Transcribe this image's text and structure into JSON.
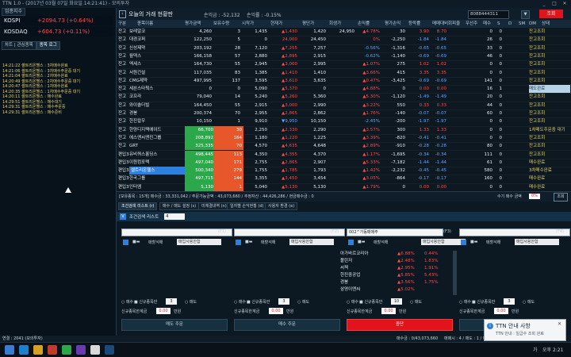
{
  "window": {
    "title": "TTN 1.0 - (2017년 03월 07일 화요일 14:21:41) - 모의투자"
  },
  "left": {
    "market_label": "업종지수",
    "indices": [
      {
        "name": "KOSPI",
        "value": "+2094.73 (+0.64%)"
      },
      {
        "name": "KOSDAQ",
        "value": "+604.73 (+0.11%)"
      }
    ],
    "tabs": [
      "차트 | 관심종목",
      "종목 로그"
    ],
    "log": [
      "14:21:22 셀트리온헬스 : 3차매수완료",
      "14:21:06 셀트리온헬스 : 3차매수주문중 대기",
      "14:21:04 셀트리온헬스 : 2차매수완료",
      "14:20:49 셀트리온헬스 : 2차매수주문중 대기",
      "14:20:47 셀트리온헬스 : 1차매수완료",
      "14:20:35 셀트리온헬스 : 1차매수주문중 대기",
      "14:20:11 셀트리온헬스 : 매수완료",
      "14:29:51 셀트리온헬스 : 매수대기",
      "14:29:31 셀트리온헬스 : 매수주문중",
      "14:29:31 셀트리온헬스 : 매수준비"
    ]
  },
  "main": {
    "title": "오늘의 거래 현황판",
    "profit_label": "손익금 : -52,132",
    "rate_label": "손익률 : -0.15%",
    "account": "8088444311",
    "query_button": "조회",
    "headers": [
      "구분",
      "종목이름",
      "평가금액",
      "보유수량",
      "시작가",
      "현재가",
      "평단가",
      "회생가",
      "손익률",
      "평가손익",
      "등락률",
      "매매대비",
      "회피율",
      "우선주",
      "매수",
      "S",
      "D",
      "SM",
      "DM",
      "상태"
    ],
    "rows": [
      {
        "type": "잔고",
        "name": "보레알코",
        "eval": "4,260",
        "qty": "3",
        "start": "1,435",
        "cur": "▲1,430",
        "avg": "1,420",
        "recov": "24,950",
        "rate": "▲4.78%",
        "pnl": "30",
        "chg": "3.90",
        "vs": "8.70",
        "c1": "0",
        "c2": "0",
        "st": "잔고조회"
      },
      {
        "type": "잔고",
        "name": "대경코퍼",
        "eval": "122,250",
        "qty": "5",
        "start": "0",
        "cur": "24,000",
        "avg": "24,450",
        "recov": "",
        "rate": "0%",
        "pnl": "-2,250",
        "chg": "-1.84",
        "vs": "-1.84",
        "c1": "26",
        "c2": "0",
        "st": "잔고조회"
      },
      {
        "type": "잔고",
        "name": "신성제약",
        "eval": "203,192",
        "qty": "28",
        "start": "7,120",
        "cur": "▲7,255",
        "avg": "7,257",
        "recov": "",
        "rate": "-0.56%",
        "pnl": "-1,316",
        "chg": "-0.65",
        "vs": "-0.65",
        "c1": "33",
        "c2": "0",
        "st": "잔고조회"
      },
      {
        "type": "잔고",
        "name": "월덱스",
        "eval": "166,158",
        "qty": "57",
        "start": "2,880",
        "cur": "▲2,895",
        "avg": "2,915",
        "recov": "",
        "rate": "-0.62%",
        "pnl": "-1,140",
        "chg": "-0.69",
        "vs": "-0.69",
        "c1": "46",
        "c2": "0",
        "st": "잔고조회"
      },
      {
        "type": "잔고",
        "name": "엑세스",
        "eval": "164,730",
        "qty": "55",
        "start": "2,945",
        "cur": "▲3,000",
        "avg": "2,995",
        "recov": "",
        "rate": "▲1.07%",
        "pnl": "275",
        "chg": "1.02",
        "vs": "1.02",
        "c1": "0",
        "c2": "0",
        "st": "잔고조회"
      },
      {
        "type": "잔고",
        "name": "서원건설",
        "eval": "117,035",
        "qty": "83",
        "start": "1,385",
        "cur": "▲1,410",
        "avg": "1,410",
        "recov": "",
        "rate": "▲3.66%",
        "pnl": "415",
        "chg": "3.35",
        "vs": "3.35",
        "c1": "0",
        "c2": "0",
        "st": "잔고조회"
      },
      {
        "type": "잔고",
        "name": "CMG제약",
        "eval": "497,995",
        "qty": "137",
        "start": "3,595",
        "cur": "▲3,610",
        "avg": "3,635",
        "recov": "",
        "rate": "▲0.47%",
        "pnl": "-3,425",
        "chg": "-0.69",
        "vs": "-0.69",
        "c1": "141",
        "c2": "0",
        "st": "잔고조회"
      },
      {
        "type": "잔고",
        "name": "세븐스타웍스",
        "eval": "0",
        "qty": "0",
        "start": "5,090",
        "cur": "▲5,370",
        "avg": "0",
        "recov": "",
        "rate": "▲4.88%",
        "pnl": "0",
        "chg": "0.00",
        "vs": "0.00",
        "c1": "16",
        "c2": "1",
        "st": "매도완료"
      },
      {
        "type": "잔고",
        "name": "코프라",
        "eval": "79,040",
        "qty": "14",
        "start": "5,240",
        "cur": "▲5,260",
        "avg": "5,360",
        "recov": "",
        "rate": "▲5.30%",
        "pnl": "-1,120",
        "chg": "-1.49",
        "vs": "-1.49",
        "c1": "20",
        "c2": "0",
        "st": "잔고조회"
      },
      {
        "type": "잔고",
        "name": "와이솔더빌",
        "eval": "164,450",
        "qty": "55",
        "start": "2,915",
        "cur": "▲3,000",
        "avg": "2,990",
        "recov": "",
        "rate": "▲3.22%",
        "pnl": "550",
        "chg": "0.33",
        "vs": "0.33",
        "c1": "44",
        "c2": "0",
        "st": "잔고조회"
      },
      {
        "type": "잔고",
        "name": "경봉",
        "eval": "200,374",
        "qty": "70",
        "start": "2,955",
        "cur": "▲2,865",
        "avg": "2,862",
        "recov": "",
        "rate": "▲1.76%",
        "pnl": "-140",
        "chg": "-0.07",
        "vs": "-0.07",
        "c1": "60",
        "c2": "0",
        "st": "잔고조회"
      },
      {
        "type": "잔고",
        "name": "한진칼우",
        "eval": "10,150",
        "qty": "1",
        "start": "9,910",
        "cur": "▼9,950",
        "avg": "10,150",
        "recov": "",
        "rate": "-2.45%",
        "pnl": "-200",
        "chg": "-1.97",
        "vs": "-1.97",
        "c1": "0",
        "c2": "0",
        "st": "잔고조회"
      },
      {
        "type": "잔고",
        "name": "한양디지텍에이드",
        "eval": "66,700",
        "qty": "30",
        "start": "2,250",
        "cur": "▲2,330",
        "avg": "2,290",
        "recov": "",
        "rate": "▲3.57%",
        "pnl": "300",
        "chg": "1.33",
        "vs": "1.33",
        "c1": "0",
        "c2": "0",
        "st": "1차매도주문중 대기"
      },
      {
        "type": "잔고",
        "name": "에스엔씨엔진그룹",
        "eval": "208,892",
        "qty": "164",
        "start": "1,180",
        "cur": "▲1,220",
        "avg": "1,225",
        "recov": "",
        "rate": "▲3.39%",
        "pnl": "-820",
        "chg": "-0.41",
        "vs": "-0.41",
        "c1": "0",
        "c2": "0",
        "st": "잔고조회"
      },
      {
        "type": "잔고",
        "name": "GRT",
        "eval": "325,335",
        "qty": "70",
        "start": "4,570",
        "cur": "▲4,635",
        "avg": "4,648",
        "recov": "",
        "rate": "▲2.89%",
        "pnl": "-910",
        "chg": "-0.28",
        "vs": "-0.28",
        "c1": "80",
        "c2": "0",
        "st": "잔고조회"
      },
      {
        "type": "편입3",
        "name": "유비쿼스홀딩스",
        "eval": "498,445",
        "qty": "113",
        "start": "4,350",
        "cur": "▲4,355",
        "avg": "4,370",
        "recov": "",
        "rate": "▲1.17%",
        "pnl": "-1,695",
        "chg": "-0.34",
        "vs": "-0.34",
        "c1": "111",
        "c2": "0",
        "st": "잔고조회"
      },
      {
        "type": "편입3",
        "name": "이원컴포텍",
        "eval": "497,040",
        "qty": "171",
        "start": "2,755",
        "cur": "▲2,865",
        "avg": "2,907",
        "recov": "",
        "rate": "▲5.33%",
        "pnl": "-7,182",
        "chg": "-1.44",
        "vs": "-1.44",
        "c1": "61",
        "c2": "0",
        "st": "매수완료"
      },
      {
        "type": "편입3",
        "name": "셀트리온헬스",
        "eval": "500,340",
        "qty": "279",
        "start": "1,755",
        "cur": "▲1,785",
        "avg": "1,793",
        "recov": "",
        "rate": "▲1.42%",
        "pnl": "-2,232",
        "chg": "-0.45",
        "vs": "-0.45",
        "c1": "580",
        "c2": "0",
        "st": "3차매수완료"
      },
      {
        "type": "편입3",
        "name": "한국그룹",
        "eval": "497,715",
        "qty": "144",
        "start": "3,355",
        "cur": "▲3,450",
        "avg": "3,454",
        "recov": "",
        "rate": "▲3.05%",
        "pnl": "-864",
        "chg": "-0.17",
        "vs": "-0.17",
        "c1": "160",
        "c2": "0",
        "st": "매수완료"
      },
      {
        "type": "편입3",
        "name": "인터엠",
        "eval": "5,130",
        "qty": "1",
        "start": "5,040",
        "cur": "▲5,130",
        "avg": "5,130",
        "recov": "",
        "rate": "▲1.79%",
        "pnl": "0",
        "chg": "0.00",
        "vs": "0.00",
        "c1": "0",
        "c2": "0",
        "st": "매수완료"
      }
    ],
    "summary": "[보유종목 : 15개]   매수금 : 33,331,042 / 주문가능금액 : 43,073,660 / 추정자산 : 44,426,286 / 현금매수금 : 0",
    "auto_label": "수기 매수 금액",
    "auto_value": "0%",
    "auto_btn": "조회"
  },
  "bottom": {
    "tabs": [
      "조건검색 리스트 (r)",
      "매수 / 매도 설정 (s)",
      "미체결내역 (n)",
      "일자별 손익현황 (d)",
      "사용자 환경 (e)"
    ],
    "cond_label": "조건검색 리스트",
    "cond_value": "4",
    "f_labels": [
      "(F1)",
      "(F2)",
      "(F3)",
      "(F4)"
    ],
    "f3_value": "002^가동매매주",
    "ck_label": "매할석해",
    "dd_label": "매입사용안함",
    "stock_list": [
      {
        "name": "아가바르코리아",
        "pct": "▲6.88%",
        "val": "0.44%"
      },
      {
        "name": "볼린저",
        "pct": "▲2.48%",
        "val": "1.83%"
      },
      {
        "name": "씨젝",
        "pct": "▲2.95%",
        "val": "1.91%"
      },
      {
        "name": "한진중공업",
        "pct": "▲5.85%",
        "val": "5.43%"
      },
      {
        "name": "경봉",
        "pct": "▲3.56%",
        "val": "1.75%"
      },
      {
        "name": "삼영이엔씨",
        "pct": "▲5.02%",
        "val": ""
      }
    ],
    "buy_label": "매수",
    "sell_label": "매도",
    "cond_order": "신규종목만",
    "max_label": "신규종목한계금",
    "max_value": "0.00",
    "unit_label": "만원",
    "buy_btn": "매도 주문",
    "sell_btn": "중단",
    "order_btn": "매수 주문",
    "status_left": "매수금 : 0/43,073,660",
    "status_right": "매매시 : 4 / 매도 : 1 / 대기 : 5"
  },
  "notification": {
    "title": "TTN 안내 사항",
    "body": "TTN 안내 : 일급수 조회 완료"
  },
  "taskbar": {
    "left_text": "연결 : 2041 (모의투자)",
    "time": "오후 2:21",
    "lang": "가"
  },
  "colors": {
    "red": "#ff4848",
    "blue": "#5aa8ff",
    "green": "#2aa84a",
    "orange": "#e8572a",
    "accent": "#2d7fe0"
  }
}
